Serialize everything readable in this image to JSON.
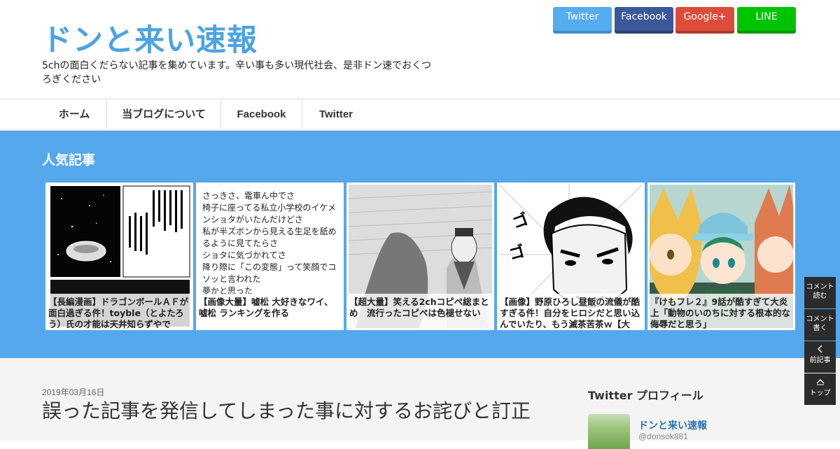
{
  "site": {
    "logo": "ドンと来い速報",
    "tagline": "5chの面白くだらない記事を集めています。辛い事も多い現代社会、是非ドン速でおくつろぎください"
  },
  "share_buttons": [
    {
      "label": "Twitter",
      "color": "#55acee",
      "shadow": "#3b8fc9"
    },
    {
      "label": "Facebook",
      "color": "#3b5998",
      "shadow": "#2b4170"
    },
    {
      "label": "Google+",
      "color": "#dd4b39",
      "shadow": "#b03a2b"
    },
    {
      "label": "LINE",
      "color": "#00c300",
      "shadow": "#009900"
    }
  ],
  "nav": {
    "items": [
      {
        "label": "ホーム"
      },
      {
        "label": "当ブログについて"
      },
      {
        "label": "Facebook"
      },
      {
        "label": "Twitter"
      }
    ]
  },
  "popular": {
    "title": "人気記事",
    "items": [
      {
        "title": "【長編漫画】ドラゴンボールＡＦが面白過ぎる件！toyble（とよたろう）氏の才能は天井知らずやで",
        "thumb": "manga-space"
      },
      {
        "title": "【画像大量】嘘松 大好きなワイ、嘘松 ランキングを作る",
        "thumb": "text-post",
        "thumb_text": "さっきさ、電車ん中でさ\n椅子に座ってる私立小学校のイケメンショタがいたんだけどさ\n私が半ズボンから見える生足を舐めるように見てたらさ\nショタに気づかれてさ\n降り際に「この変態」って笑顔でコソッと言われた\n夢かと思った"
      },
      {
        "title": "【超大量】笑える2chコピペ総まとめ　流行ったコピペは色褪せない",
        "thumb": "manga-general"
      },
      {
        "title": "【画像】野原ひろし昼飯の流儀が酷すぎる件！自分をヒロシだと思い込んでいたり、もう滅茶苦茶ｗ【大量】",
        "thumb": "manga-face"
      },
      {
        "title": "『けもフレ２』9話が酷すぎて大炎上「動物のいのちに対する根本的な侮辱だと思う」",
        "thumb": "anime"
      }
    ]
  },
  "article": {
    "date": "2019年03月16日",
    "title": "誤った記事を発信してしまった事に対するお詫びと訂正"
  },
  "sidebar": {
    "twitter_title": "Twitter プロフィール",
    "name": "ドンと来い速報",
    "handle": "@donsok881"
  },
  "floating": [
    {
      "label": "コメント\n読む",
      "icon": "none"
    },
    {
      "label": "コメント\n書く",
      "icon": "none"
    },
    {
      "label": "前記事",
      "icon": "chevron-left-icon"
    },
    {
      "label": "トップ",
      "icon": "chevron-up-icon"
    }
  ]
}
